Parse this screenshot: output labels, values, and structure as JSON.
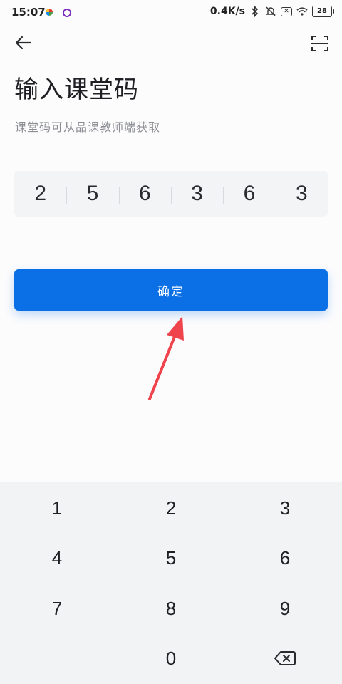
{
  "status_bar": {
    "time": "15:07",
    "net_speed": "0.4K/s",
    "battery_level": "28",
    "icons": [
      "bluetooth-icon",
      "mute-bell-icon",
      "sim-x-icon",
      "wifi-icon",
      "battery-icon"
    ]
  },
  "header": {
    "back_icon": "back-arrow-icon",
    "scan_icon": "scan-icon"
  },
  "page": {
    "title": "输入课堂码",
    "subtitle": "课堂码可从品课教师端获取"
  },
  "code": {
    "digits": [
      "2",
      "5",
      "6",
      "3",
      "6",
      "3"
    ]
  },
  "confirm": {
    "label": "确定"
  },
  "annotation": {
    "arrow_color": "#f0444d"
  },
  "keypad": {
    "keys": [
      "1",
      "2",
      "3",
      "4",
      "5",
      "6",
      "7",
      "8",
      "9",
      "0"
    ],
    "delete_icon": "backspace-icon"
  },
  "colors": {
    "accent": "#0b6fe6"
  }
}
